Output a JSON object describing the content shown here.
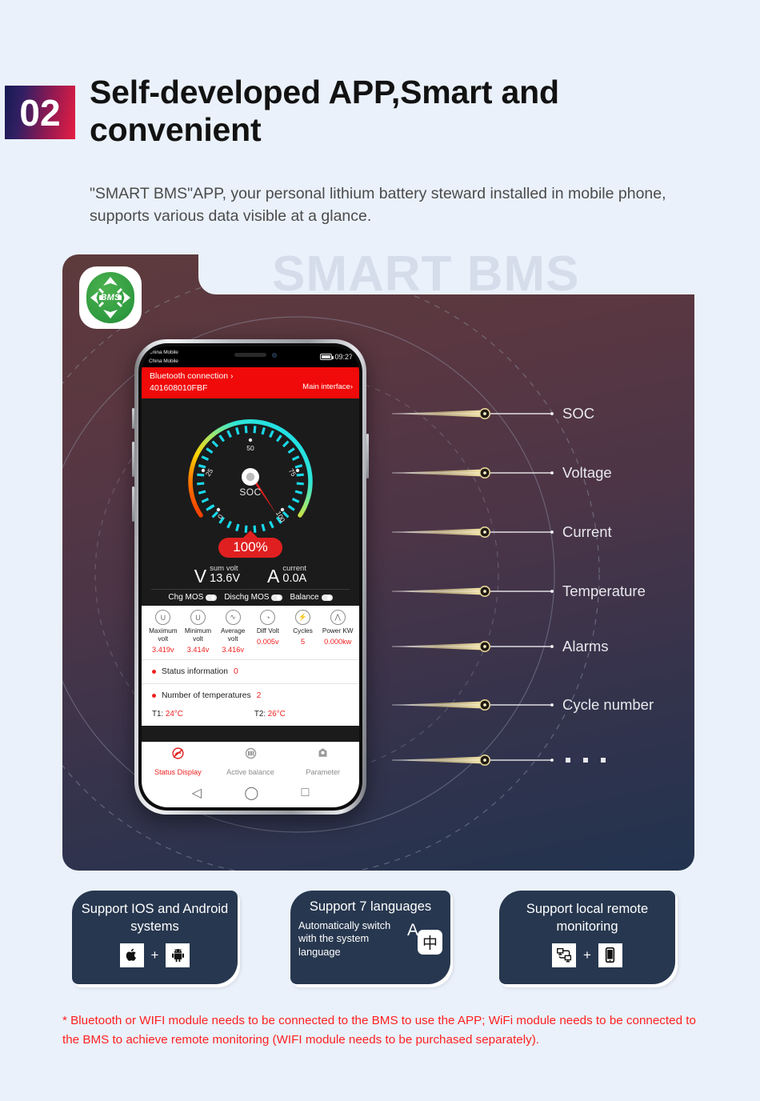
{
  "header": {
    "badge_number": "02",
    "title": "Self-developed APP,Smart and convenient",
    "subtitle": "\"SMART BMS\"APP, your personal lithium battery steward installed in mobile phone, supports various data visible at a glance."
  },
  "panel": {
    "watermark": "SMART BMS",
    "logo_text": "BMS"
  },
  "phone": {
    "status_bar": {
      "carrier_line1": "China Mobile",
      "carrier_line2": "China Mobile",
      "clock": "09:27"
    },
    "app_header": {
      "bluetooth": "Bluetooth connection ›",
      "main_interface": "Main interface›",
      "device_id": "401608010FBF"
    },
    "gauge": {
      "center_label": "SOC",
      "percent_badge": "100%",
      "ticks": [
        "0",
        "25",
        "50",
        "75",
        "100"
      ],
      "value": 100
    },
    "summary": [
      {
        "icon": "voltmeter-icon",
        "glyph": "V",
        "label": "sum volt",
        "value": "13.6V"
      },
      {
        "icon": "ammeter-icon",
        "glyph": "A",
        "label": "current",
        "value": "0.0A"
      }
    ],
    "mos_switches": [
      {
        "label": "Chg MOS",
        "state": "on"
      },
      {
        "label": "Dischg MOS",
        "state": "on"
      },
      {
        "label": "Balance",
        "state": "on"
      }
    ],
    "stats": [
      {
        "icon": "voltage-up-icon",
        "glyph": "Ⓤ",
        "name": "Maximum volt",
        "value": "3.419v"
      },
      {
        "icon": "voltage-down-icon",
        "glyph": "Ⓤ",
        "name": "Minimum volt",
        "value": "3.414v"
      },
      {
        "icon": "wave-icon",
        "glyph": "∿",
        "name": "Average volt",
        "value": "3.416v"
      },
      {
        "icon": "gauge-icon",
        "glyph": "◴",
        "name": "Diff Volt",
        "value": "0.005v"
      },
      {
        "icon": "bolt-icon",
        "glyph": "⚡",
        "name": "Cycles",
        "value": "5"
      },
      {
        "icon": "pulse-icon",
        "glyph": "⨍",
        "name": "Power KW",
        "value": "0.000kw"
      }
    ],
    "status_information": {
      "label": "Status information",
      "value": "0"
    },
    "temperature_count": {
      "label": "Number of temperatures",
      "value": "2"
    },
    "temperatures": [
      {
        "label": "T1:",
        "value": "24°C"
      },
      {
        "label": "T2:",
        "value": "26°C"
      }
    ],
    "tabs": [
      {
        "icon": "status-display-icon",
        "label": "Status Display",
        "active": true
      },
      {
        "icon": "active-balance-icon",
        "label": "Active balance",
        "active": false
      },
      {
        "icon": "parameter-icon",
        "label": "Parameter",
        "active": false
      }
    ],
    "nav": [
      {
        "icon": "back-triangle-icon",
        "glyph": "◁"
      },
      {
        "icon": "home-circle-icon",
        "glyph": "◯"
      },
      {
        "icon": "recents-square-icon",
        "glyph": "□"
      }
    ]
  },
  "pointers": [
    {
      "label": "SOC"
    },
    {
      "label": "Voltage"
    },
    {
      "label": "Current"
    },
    {
      "label": "Temperature"
    },
    {
      "label": "Alarms"
    },
    {
      "label": "Cycle number"
    },
    {
      "label": ""
    }
  ],
  "cards": [
    {
      "title": "Support IOS and Android systems",
      "icons": [
        "apple-icon",
        "android-icon"
      ],
      "plus": "+"
    },
    {
      "title": "Support 7 languages",
      "body": "Automatically switch with the system language",
      "icons": [
        "language-translate-icon"
      ],
      "glyph_a": "A",
      "glyph_cjk": "中"
    },
    {
      "title": "Support local remote monitoring",
      "icons": [
        "network-devices-icon",
        "smartphone-icon"
      ],
      "plus": "+"
    }
  ],
  "footnote": "* Bluetooth or WIFI module needs to be connected to the BMS to use the APP; WiFi module needs to be connected to the BMS to achieve remote monitoring (WIFI module needs to be purchased separately).",
  "colors": {
    "accent_red": "#f02020",
    "panel_top": "#5d3a3c",
    "panel_bottom": "#22334f",
    "card_bg": "#27374f",
    "page_bg": "#eaf1fb",
    "badge_gradient_from": "#151a52",
    "badge_gradient_to": "#e71e42",
    "gold": "#e7d79a"
  }
}
